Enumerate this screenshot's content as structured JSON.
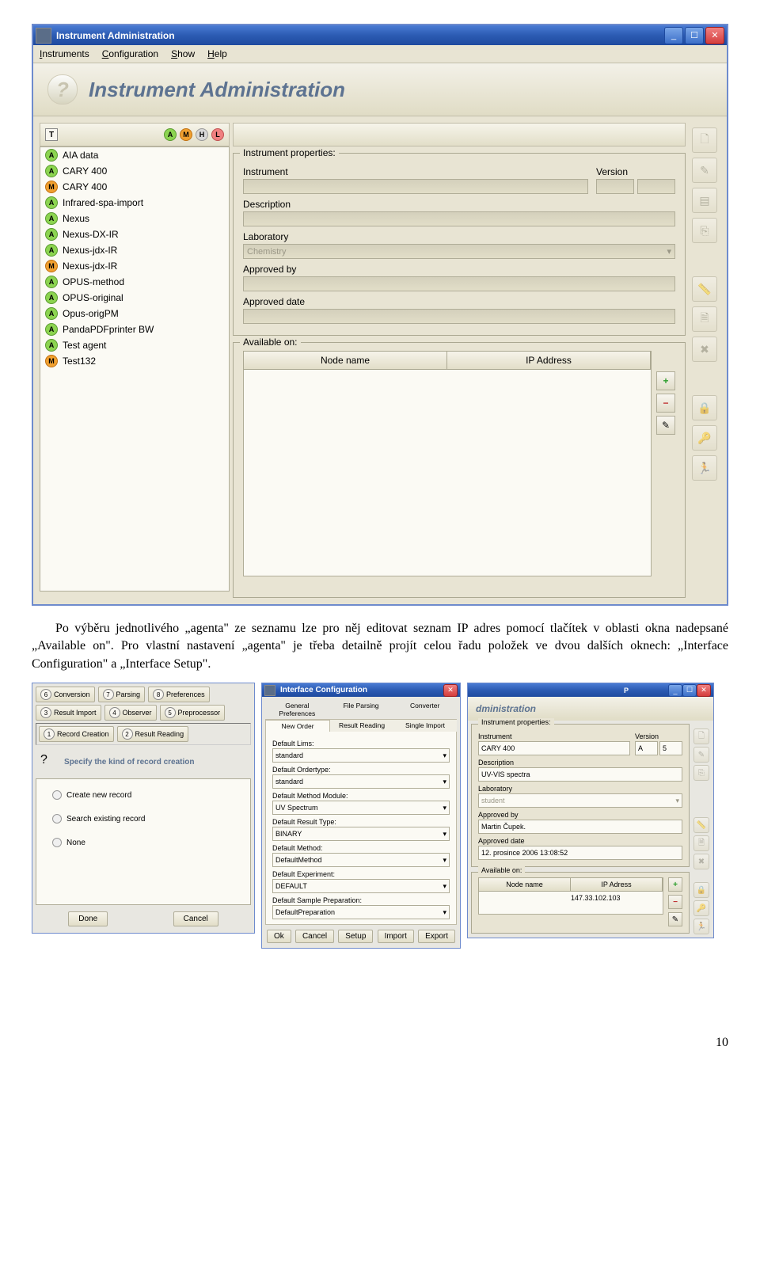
{
  "para1": "Po výběru jednotlivého „agenta\" ze seznamu lze pro něj editovat seznam IP adres pomocí tlačítek v oblasti okna nadepsané „Available on\". Pro vlastní nastavení „agenta\" je třeba detailně projít celou řadu položek ve dvou dalších oknech: „Interface Configuration\" a „Interface Setup\".",
  "mainwin": {
    "title": "Instrument Administration",
    "menu": {
      "instruments": "Instruments",
      "configuration": "Configuration",
      "show": "Show",
      "help": "Help"
    },
    "banner": "Instrument Administration",
    "items": [
      {
        "t": "A",
        "n": "AIA data"
      },
      {
        "t": "A",
        "n": "CARY 400"
      },
      {
        "t": "M",
        "n": "CARY 400"
      },
      {
        "t": "A",
        "n": "Infrared-spa-import"
      },
      {
        "t": "A",
        "n": "Nexus"
      },
      {
        "t": "A",
        "n": "Nexus-DX-IR"
      },
      {
        "t": "A",
        "n": "Nexus-jdx-IR"
      },
      {
        "t": "M",
        "n": "Nexus-jdx-IR"
      },
      {
        "t": "A",
        "n": "OPUS-method"
      },
      {
        "t": "A",
        "n": "OPUS-original"
      },
      {
        "t": "A",
        "n": "Opus-origPM"
      },
      {
        "t": "A",
        "n": "PandaPDFprinter BW"
      },
      {
        "t": "A",
        "n": "Test agent"
      },
      {
        "t": "M",
        "n": "Test132"
      }
    ],
    "props": {
      "group": "Instrument properties:",
      "instrument": "Instrument",
      "version": "Version",
      "description": "Description",
      "laboratory": "Laboratory",
      "labval": "Chemistry",
      "approvedby": "Approved by",
      "approveddate": "Approved date"
    },
    "avail": {
      "group": "Available on:",
      "col1": "Node name",
      "col2": "IP Address"
    }
  },
  "leftsmall": {
    "tabs": {
      "conv": "Conversion",
      "pars": "Parsing",
      "pref": "Preferences",
      "resi": "Result Import",
      "obs": "Observer",
      "prep": "Preprocessor",
      "rec": "Record Creation",
      "read": "Result Reading"
    },
    "prompt": "Specify the kind of record creation",
    "opts": {
      "create": "Create new record",
      "search": "Search existing record",
      "none": "None"
    },
    "btns": {
      "done": "Done",
      "cancel": "Cancel"
    }
  },
  "midsmall": {
    "title": "Interface Configuration",
    "tabs": {
      "gp": "General Preferences",
      "fp": "File Parsing",
      "cv": "Converter",
      "no": "New Order",
      "rr": "Result Reading",
      "si": "Single Import"
    },
    "lbls": {
      "lims": "Default Lims:",
      "ordertype": "Default Ordertype:",
      "mm": "Default Method Module:",
      "rt": "Default Result Type:",
      "m": "Default Method:",
      "exp": "Default Experiment:",
      "sp": "Default Sample Preparation:"
    },
    "vals": {
      "lims": "standard",
      "ordertype": "standard",
      "mm": "UV Spectrum",
      "rt": "BINARY",
      "m": "DefaultMethod",
      "exp": "DEFAULT",
      "sp": "DefaultPreparation"
    },
    "btns": {
      "ok": "Ok",
      "cancel": "Cancel",
      "setup": "Setup",
      "import": "Import",
      "export": "Export"
    }
  },
  "rightsmall": {
    "title": "dministration",
    "props": {
      "group": "Instrument properties:",
      "instrument": "Instrument",
      "version": "Version",
      "iv": "CARY 400",
      "v1": "A",
      "v2": "5",
      "desc": "Description",
      "descv": "UV-VIS spectra",
      "lab": "Laboratory",
      "labv": "student",
      "appby": "Approved by",
      "appbyv": "Martin Čupek.",
      "appdate": "Approved date",
      "appdatev": "12. prosince 2006 13:08:52"
    },
    "avail": {
      "group": "Available on:",
      "col1": "Node name",
      "col2": "IP Adress",
      "ipv": "147.33.102.103"
    }
  },
  "pageno": "10"
}
